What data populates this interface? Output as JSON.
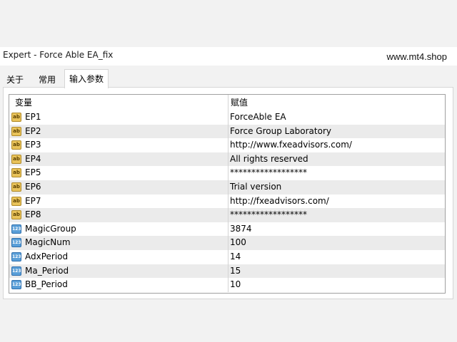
{
  "window": {
    "title": "Expert - Force Able EA_fix",
    "watermark": "www.mt4.shop"
  },
  "tabs": [
    {
      "label": "关于"
    },
    {
      "label": "常用"
    },
    {
      "label": "输入参数"
    }
  ],
  "active_tab": "输入参数",
  "table": {
    "columns": [
      "变量",
      "赋值"
    ],
    "rows": [
      {
        "type": "string",
        "icon": "ab",
        "name": "EP1",
        "value": "ForceAble EA"
      },
      {
        "type": "string",
        "icon": "ab",
        "name": "EP2",
        "value": "Force Group Laboratory"
      },
      {
        "type": "string",
        "icon": "ab",
        "name": "EP3",
        "value": "http://www.fxeadvisors.com/"
      },
      {
        "type": "string",
        "icon": "ab",
        "name": "EP4",
        "value": "All rights reserved"
      },
      {
        "type": "string",
        "icon": "ab",
        "name": "EP5",
        "value": "******************"
      },
      {
        "type": "string",
        "icon": "ab",
        "name": "EP6",
        "value": "Trial version"
      },
      {
        "type": "string",
        "icon": "ab",
        "name": "EP7",
        "value": "http://fxeadvisors.com/"
      },
      {
        "type": "string",
        "icon": "ab",
        "name": "EP8",
        "value": "******************"
      },
      {
        "type": "number",
        "icon": "123",
        "name": "MagicGroup",
        "value": "3874"
      },
      {
        "type": "number",
        "icon": "123",
        "name": "MagicNum",
        "value": "100"
      },
      {
        "type": "number",
        "icon": "123",
        "name": "AdxPeriod",
        "value": "14"
      },
      {
        "type": "number",
        "icon": "123",
        "name": "Ma_Period",
        "value": "15"
      },
      {
        "type": "number",
        "icon": "123",
        "name": "BB_Period",
        "value": "10"
      }
    ]
  },
  "colors": {
    "string_icon": "#e8c25a",
    "number_icon": "#5a9fd8",
    "alt_row": "#ebebeb"
  }
}
